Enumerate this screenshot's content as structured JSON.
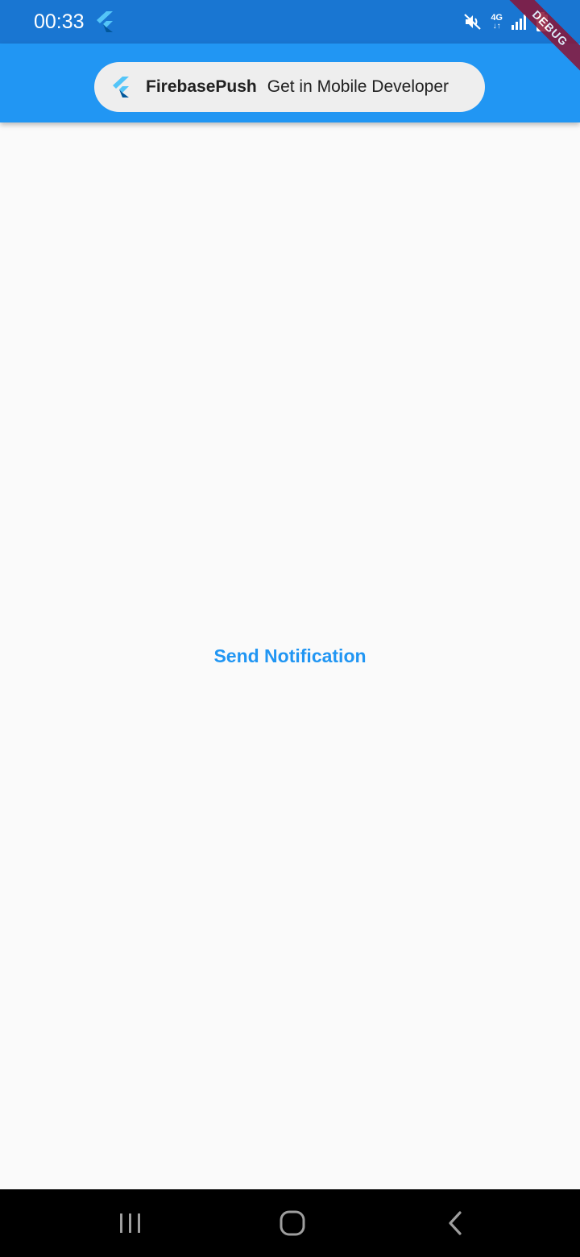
{
  "status_bar": {
    "time": "00:33",
    "network_label": "4G",
    "background_color": "#1976d2",
    "icons": [
      "flutter-icon",
      "mute-icon",
      "network-4g-icon",
      "signal-icon",
      "battery-icon"
    ]
  },
  "debug_banner": {
    "label": "DEBUG"
  },
  "app_bar": {
    "background_color": "#2196f3",
    "title_pill": {
      "logo_icon": "flutter-logo-icon",
      "name": "FirebasePush",
      "tagline": "Get in Mobile Developer"
    }
  },
  "main": {
    "send_button_label": "Send Notification",
    "accent_color": "#2196f3"
  },
  "nav_bar": {
    "icons": [
      "recent-apps-icon",
      "home-icon",
      "back-icon"
    ]
  }
}
